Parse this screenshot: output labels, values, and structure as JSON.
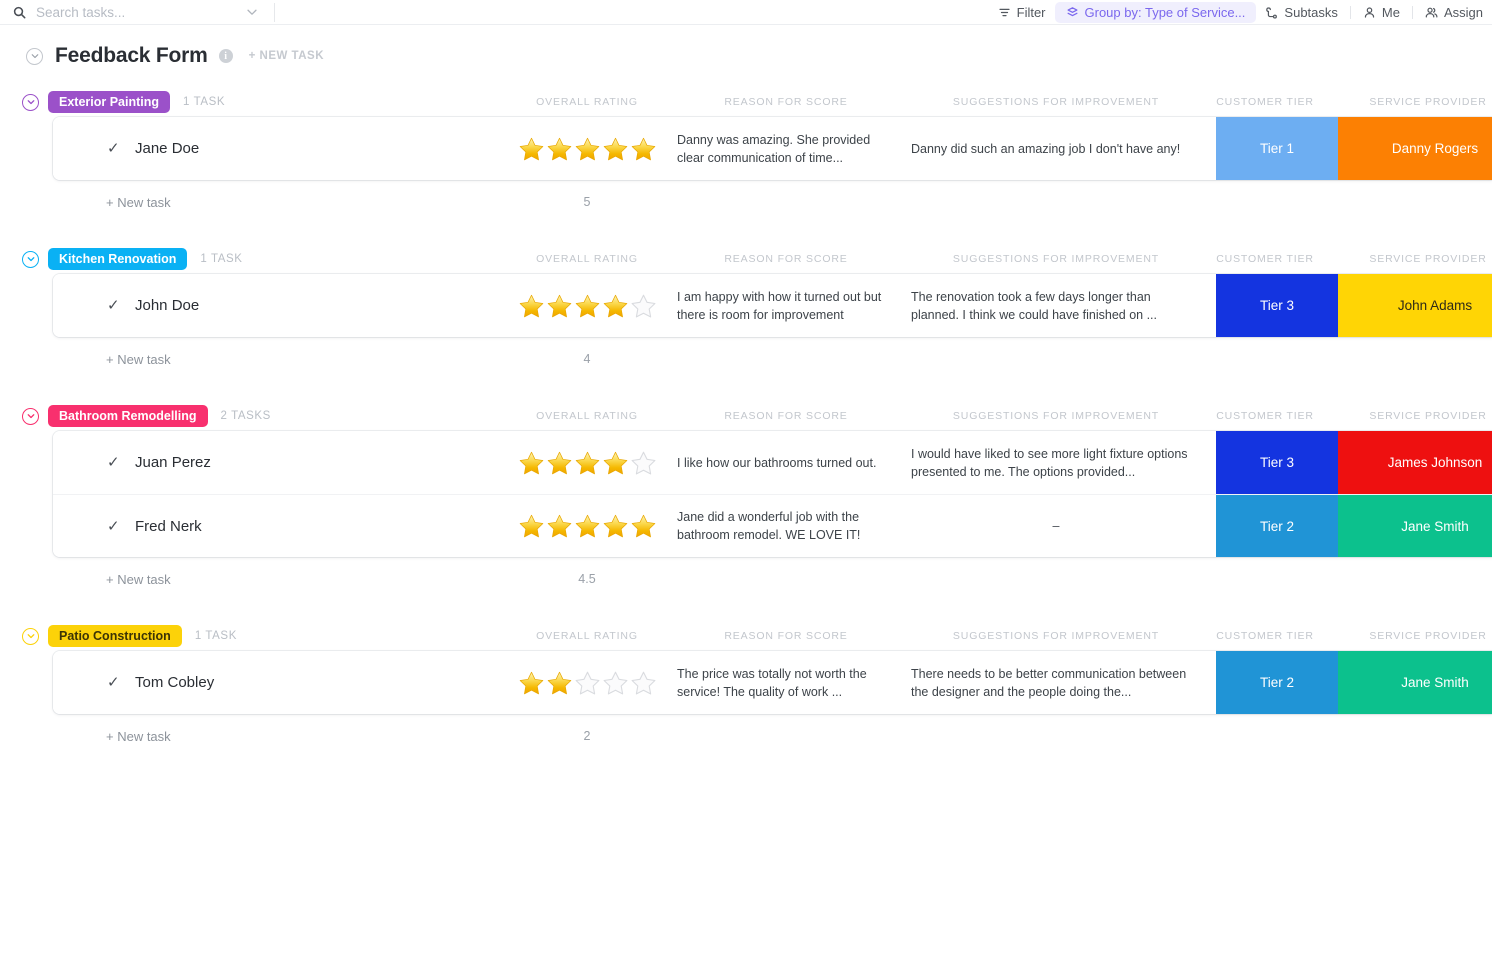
{
  "search": {
    "placeholder": "Search tasks...",
    "value": "",
    "icon": "search-icon",
    "chevron_icon": "chevron-down-icon"
  },
  "toolbar": {
    "filter": {
      "label": "Filter",
      "icon": "filter-icon"
    },
    "group_by": {
      "label": "Group by: Type of Service...",
      "icon": "group-by-icon",
      "active_color": "#7b68ee"
    },
    "subtasks": {
      "label": "Subtasks",
      "icon": "subtasks-icon"
    },
    "me": {
      "label": "Me",
      "icon": "person-icon"
    },
    "assignee": {
      "label": "Assign",
      "icon": "people-icon"
    }
  },
  "page": {
    "title": "Feedback Form",
    "info_icon": "info-icon",
    "new_task_label": "+ NEW TASK",
    "collapse_icon": "chevron-down-circle-icon"
  },
  "columns": {
    "rating": "OVERALL RATING",
    "reason": "REASON FOR SCORE",
    "suggestions": "SUGGESTIONS FOR IMPROVEMENT",
    "tier": "CUSTOMER TIER",
    "provider": "SERVICE PROVIDER"
  },
  "common": {
    "new_task": "+ New task"
  },
  "groups": [
    {
      "name": "Exterior Painting",
      "color": "#9b51c9",
      "count_label": "1 TASK",
      "aggregate": "5",
      "tasks": [
        {
          "name": "Jane Doe",
          "stars": 5,
          "reason": "Danny was amazing. She provided clear communication of time...",
          "suggestion": "Danny did such an amazing job I don't have any!",
          "tier": {
            "label": "Tier 1",
            "color": "#6daef2",
            "dark_text": false
          },
          "provider": {
            "label": "Danny Rogers",
            "color": "#fc8003",
            "dark_text": false
          }
        }
      ]
    },
    {
      "name": "Kitchen Renovation",
      "color": "#0ab1f4",
      "count_label": "1 TASK",
      "aggregate": "4",
      "tasks": [
        {
          "name": "John Doe",
          "stars": 4,
          "reason": "I am happy with how it turned out but there is room for improvement",
          "suggestion": "The renovation took a few days longer than planned. I think we could have finished on ...",
          "tier": {
            "label": "Tier 3",
            "color": "#1434e0",
            "dark_text": false
          },
          "provider": {
            "label": "John Adams",
            "color": "#ffd505",
            "dark_text": true
          }
        }
      ]
    },
    {
      "name": "Bathroom Remodelling",
      "color": "#f8306e",
      "count_label": "2 TASKS",
      "aggregate": "4.5",
      "tasks": [
        {
          "name": "Juan Perez",
          "stars": 4,
          "reason": "I like how our bathrooms turned out.",
          "suggestion": "I would have liked to see more light fixture options presented to me. The options provided...",
          "tier": {
            "label": "Tier 3",
            "color": "#1434e0",
            "dark_text": false
          },
          "provider": {
            "label": "James Johnson",
            "color": "#ee1010",
            "dark_text": false
          }
        },
        {
          "name": "Fred Nerk",
          "stars": 5,
          "reason": "Jane did a wonderful job with the bathroom remodel. WE LOVE IT!",
          "suggestion": "–",
          "tier": {
            "label": "Tier 2",
            "color": "#2094d6",
            "dark_text": false
          },
          "provider": {
            "label": "Jane Smith",
            "color": "#0cc18d",
            "dark_text": false
          }
        }
      ]
    },
    {
      "name": "Patio Construction",
      "color": "#fcd209",
      "count_label": "1 TASK",
      "aggregate": "2",
      "tasks": [
        {
          "name": "Tom Cobley",
          "stars": 2,
          "reason": "The price was totally not worth the service! The quality of work ...",
          "suggestion": "There needs to be better communication between the designer and the people doing the...",
          "tier": {
            "label": "Tier 2",
            "color": "#2094d6",
            "dark_text": false
          },
          "provider": {
            "label": "Jane Smith",
            "color": "#0cc18d",
            "dark_text": false
          }
        }
      ]
    }
  ]
}
